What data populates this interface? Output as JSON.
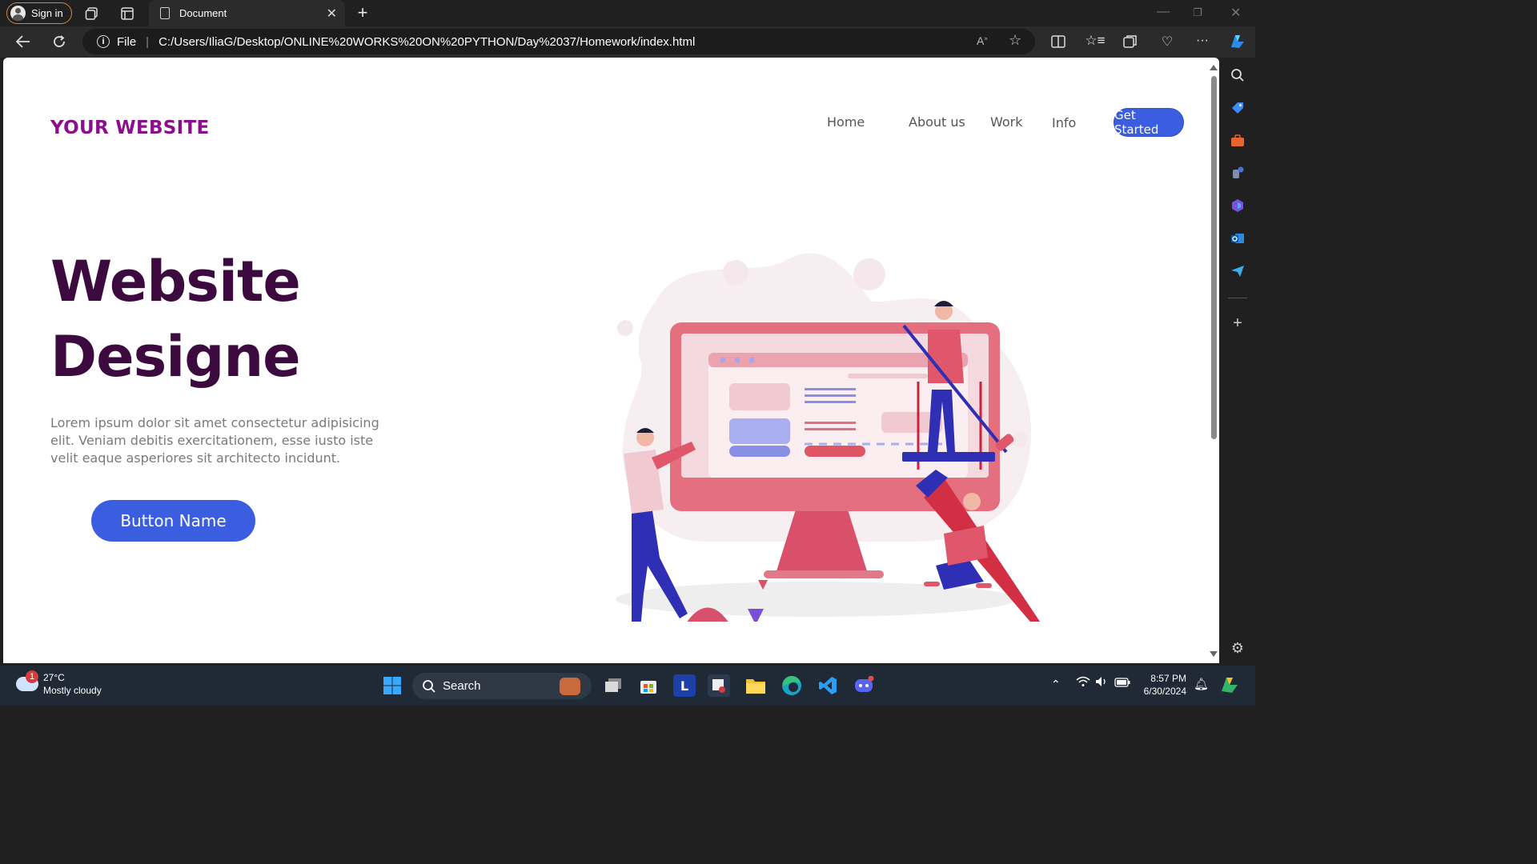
{
  "browser": {
    "sign_in": "Sign in",
    "tab_title": "Document",
    "file_label": "File",
    "url": "C:/Users/IliaG/Desktop/ONLINE%20WORKS%20ON%20PYTHON/Day%2037/Homework/index.html"
  },
  "page": {
    "logo": "YOUR WEBSITE",
    "nav": [
      "Home",
      "About us",
      "Work",
      "Info"
    ],
    "cta": "Get Started",
    "hero_line1": "Website",
    "hero_line2": "Designe",
    "hero_text": "Lorem ipsum dolor sit amet consectetur adipisicing elit. Veniam debitis exercitationem, esse iusto iste velit eaque asperiores sit architecto incidunt.",
    "hero_button": "Button Name"
  },
  "taskbar": {
    "weather_temp": "27°C",
    "weather_desc": "Mostly cloudy",
    "weather_badge": "1",
    "search": "Search",
    "time": "8:57 PM",
    "date": "6/30/2024"
  },
  "colors": {
    "logo": "#8b0f8b",
    "hero_title": "#3d0a3f",
    "accent": "#3b5ee0"
  }
}
